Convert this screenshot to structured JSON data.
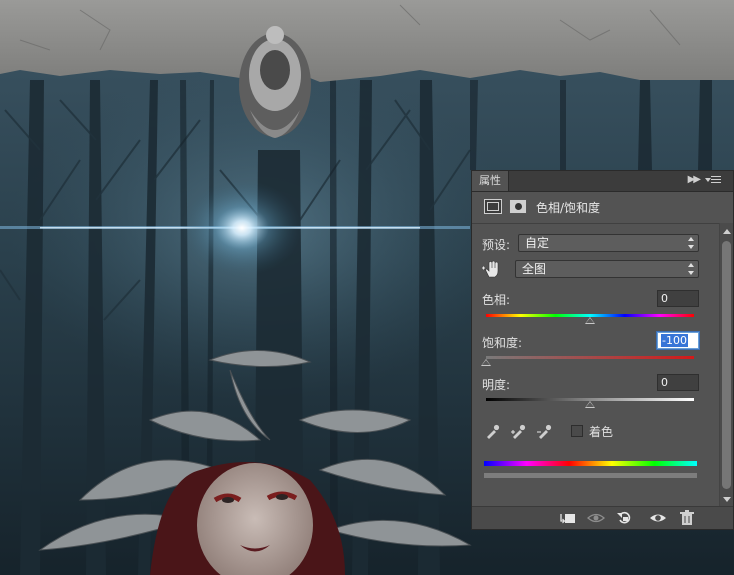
{
  "panel": {
    "tab_label": "属性",
    "header_title": "色相/饱和度",
    "preset": {
      "label": "预设:",
      "value": "自定"
    },
    "channel": {
      "value": "全图"
    },
    "hue": {
      "label": "色相:",
      "value": "0",
      "level": 0.5
    },
    "saturation": {
      "label": "饱和度:",
      "value": "-100",
      "level": 0.0
    },
    "lightness": {
      "label": "明度:",
      "value": "0",
      "level": 0.5
    },
    "colorize": {
      "label": "着色",
      "checked": false
    }
  },
  "icons": {
    "collapse": "double-chevron-right-icon",
    "menu": "panel-menu-icon",
    "adjustment": "adjustment-layer-icon",
    "mask": "layer-mask-icon",
    "target": "targeted-adjustment-hand-icon",
    "eyedroppers": [
      "eyedropper-icon",
      "eyedropper-plus-icon",
      "eyedropper-minus-icon"
    ],
    "footer": [
      "clip-to-layer-icon",
      "view-previous-state-icon",
      "reset-icon",
      "visibility-eye-icon",
      "delete-trash-icon"
    ]
  }
}
